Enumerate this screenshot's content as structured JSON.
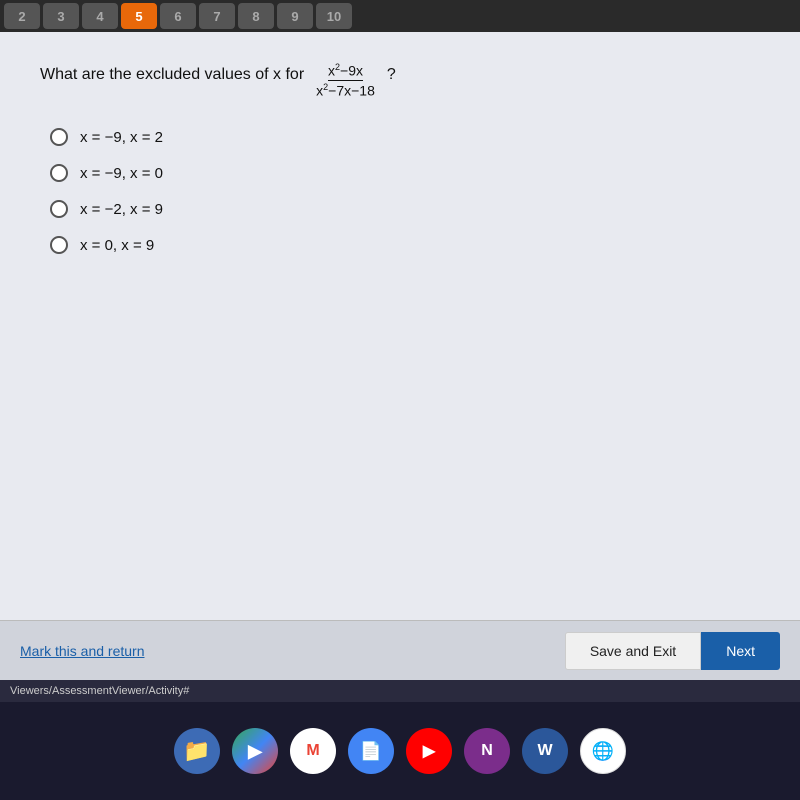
{
  "topbar": {
    "buttons": [
      {
        "label": "2",
        "state": "inactive"
      },
      {
        "label": "3",
        "state": "inactive"
      },
      {
        "label": "4",
        "state": "inactive"
      },
      {
        "label": "5",
        "state": "active"
      },
      {
        "label": "6",
        "state": "inactive"
      },
      {
        "label": "7",
        "state": "inactive"
      },
      {
        "label": "8",
        "state": "inactive"
      },
      {
        "label": "9",
        "state": "inactive"
      },
      {
        "label": "10",
        "state": "inactive"
      }
    ]
  },
  "question": {
    "text_prefix": "What are the excluded values of x for",
    "fraction_numerator": "x²−9x",
    "fraction_denominator": "x²−7x−18",
    "text_suffix": "?"
  },
  "options": [
    {
      "id": "a",
      "label": "x = −9, x = 2"
    },
    {
      "id": "b",
      "label": "x = −9, x = 0"
    },
    {
      "id": "c",
      "label": "x = −2, x = 9"
    },
    {
      "id": "d",
      "label": "x = 0, x = 9"
    }
  ],
  "bottom": {
    "mark_return": "Mark this and return",
    "save_exit": "Save and Exit",
    "next": "Next"
  },
  "taskbar": {
    "url": "Viewers/AssessmentViewer/Activity#",
    "icons": [
      {
        "name": "files",
        "symbol": "📁",
        "class": "icon-files"
      },
      {
        "name": "play-store",
        "symbol": "▶",
        "class": "icon-play"
      },
      {
        "name": "gmail",
        "symbol": "M",
        "class": "icon-gmail"
      },
      {
        "name": "docs",
        "symbol": "📄",
        "class": "icon-docs"
      },
      {
        "name": "youtube",
        "symbol": "▶",
        "class": "icon-youtube"
      },
      {
        "name": "ms-office",
        "symbol": "N",
        "class": "icon-ms"
      },
      {
        "name": "word",
        "symbol": "W",
        "class": "icon-word"
      },
      {
        "name": "chrome",
        "symbol": "⊙",
        "class": "icon-chrome"
      }
    ]
  }
}
